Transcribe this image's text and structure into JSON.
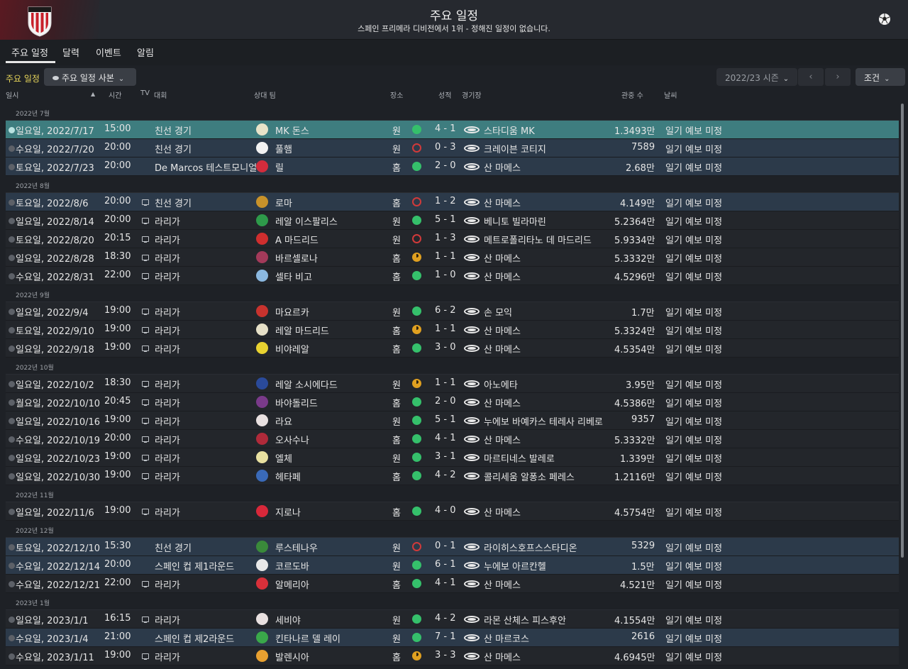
{
  "header": {
    "title": "주요 일정",
    "subtitle": "스페인 프리메라 디비전에서 1위 - 정해진 일정이 없습니다."
  },
  "tabs": [
    "주요 일정",
    "달력",
    "이벤트",
    "알림"
  ],
  "toolbar": {
    "section_title": "주요 일정",
    "view_dropdown": "주요 일정 사본",
    "season": "2022/23 시즌",
    "prev": "‹",
    "next": "›",
    "filter": "조건"
  },
  "columns": {
    "date": "일시",
    "time": "시간",
    "tv": "TV",
    "competition": "대회",
    "opponent": "상대 팀",
    "venue": "장소",
    "result": "성적",
    "stadium": "경기장",
    "attendance": "관중 수",
    "weather": "날씨"
  },
  "groups": [
    {
      "label": "2022년 7월",
      "matches": [
        {
          "date": "일요일, 2022/7/17",
          "time": "15:00",
          "tv": false,
          "comp": "친선 경기",
          "opp": "MK 돈스",
          "badge": "#e8e3c8",
          "venue": "원",
          "res": "w",
          "score": "4 - 1",
          "stadium": "스타디움 MK",
          "att": "1.3493만",
          "weather": "일기 예보 미정",
          "style": "sel"
        },
        {
          "date": "수요일, 2022/7/20",
          "time": "20:00",
          "tv": false,
          "comp": "친선 경기",
          "opp": "풀햄",
          "badge": "#f2f2f2",
          "venue": "원",
          "res": "l",
          "score": "0 - 3",
          "stadium": "크레이븐 코티지",
          "att": "7589",
          "weather": "일기 예보 미정",
          "style": "blue"
        },
        {
          "date": "토요일, 2022/7/23",
          "time": "20:00",
          "tv": false,
          "comp": "De Marcos 테스트모니얼",
          "opp": "릴",
          "badge": "#d32c3c",
          "venue": "홈",
          "res": "w",
          "score": "2 - 0",
          "stadium": "산 마메스",
          "att": "2.68만",
          "weather": "일기 예보 미정",
          "style": "blue"
        }
      ]
    },
    {
      "label": "2022년 8월",
      "matches": [
        {
          "date": "토요일, 2022/8/6",
          "time": "20:00",
          "tv": true,
          "comp": "친선 경기",
          "opp": "로마",
          "badge": "#c8922a",
          "venue": "홈",
          "res": "l",
          "score": "1 - 2",
          "stadium": "산 마메스",
          "att": "4.149만",
          "weather": "일기 예보 미정",
          "style": "blue"
        },
        {
          "date": "일요일, 2022/8/14",
          "time": "20:00",
          "tv": true,
          "comp": "라리가",
          "opp": "레알 이스팔리스",
          "badge": "#2e9a4a",
          "venue": "원",
          "res": "w",
          "score": "5 - 1",
          "stadium": "베니토 빌라마린",
          "att": "5.2364만",
          "weather": "일기 예보 미정",
          "style": ""
        },
        {
          "date": "토요일, 2022/8/20",
          "time": "20:15",
          "tv": true,
          "comp": "라리가",
          "opp": "A 마드리드",
          "badge": "#cf2e2e",
          "venue": "원",
          "res": "l",
          "score": "1 - 3",
          "stadium": "메트로폴리타노 데 마드리드",
          "att": "5.9334만",
          "weather": "일기 예보 미정",
          "style": ""
        },
        {
          "date": "일요일, 2022/8/28",
          "time": "18:30",
          "tv": true,
          "comp": "라리가",
          "opp": "바르셀로나",
          "badge": "#a33a5a",
          "venue": "홈",
          "res": "d",
          "score": "1 - 1",
          "stadium": "산 마메스",
          "att": "5.3332만",
          "weather": "일기 예보 미정",
          "style": ""
        },
        {
          "date": "수요일, 2022/8/31",
          "time": "22:00",
          "tv": true,
          "comp": "라리가",
          "opp": "셀타 비고",
          "badge": "#8bb8e0",
          "venue": "홈",
          "res": "w",
          "score": "1 - 0",
          "stadium": "산 마메스",
          "att": "4.5296만",
          "weather": "일기 예보 미정",
          "style": ""
        }
      ]
    },
    {
      "label": "2022년 9월",
      "matches": [
        {
          "date": "일요일, 2022/9/4",
          "time": "19:00",
          "tv": true,
          "comp": "라리가",
          "opp": "마요르카",
          "badge": "#c8332e",
          "venue": "원",
          "res": "w",
          "score": "6 - 2",
          "stadium": "손 모익",
          "att": "1.7만",
          "weather": "일기 예보 미정",
          "style": ""
        },
        {
          "date": "토요일, 2022/9/10",
          "time": "19:00",
          "tv": true,
          "comp": "라리가",
          "opp": "레알 마드리드",
          "badge": "#e6e0c8",
          "venue": "홈",
          "res": "d",
          "score": "1 - 1",
          "stadium": "산 마메스",
          "att": "5.3324만",
          "weather": "일기 예보 미정",
          "style": ""
        },
        {
          "date": "일요일, 2022/9/18",
          "time": "19:00",
          "tv": true,
          "comp": "라리가",
          "opp": "비야레알",
          "badge": "#e8d230",
          "venue": "홈",
          "res": "w",
          "score": "3 - 0",
          "stadium": "산 마메스",
          "att": "4.5354만",
          "weather": "일기 예보 미정",
          "style": ""
        }
      ]
    },
    {
      "label": "2022년 10월",
      "matches": [
        {
          "date": "일요일, 2022/10/2",
          "time": "18:30",
          "tv": true,
          "comp": "라리가",
          "opp": "레알 소시에다드",
          "badge": "#2a4a9a",
          "venue": "원",
          "res": "d",
          "score": "1 - 1",
          "stadium": "아노에타",
          "att": "3.95만",
          "weather": "일기 예보 미정",
          "style": ""
        },
        {
          "date": "월요일, 2022/10/10",
          "time": "20:45",
          "tv": true,
          "comp": "라리가",
          "opp": "바야돌리드",
          "badge": "#7a3a8a",
          "venue": "홈",
          "res": "w",
          "score": "2 - 0",
          "stadium": "산 마메스",
          "att": "4.5386만",
          "weather": "일기 예보 미정",
          "style": ""
        },
        {
          "date": "일요일, 2022/10/16",
          "time": "19:00",
          "tv": true,
          "comp": "라리가",
          "opp": "라요",
          "badge": "#e8e0e0",
          "venue": "원",
          "res": "w",
          "score": "5 - 1",
          "stadium": "누에보 바예카스 테레사 리베로",
          "att": "9357",
          "weather": "일기 예보 미정",
          "style": ""
        },
        {
          "date": "수요일, 2022/10/19",
          "time": "20:00",
          "tv": true,
          "comp": "라리가",
          "opp": "오사수나",
          "badge": "#b02a3a",
          "venue": "홈",
          "res": "w",
          "score": "4 - 1",
          "stadium": "산 마메스",
          "att": "5.3332만",
          "weather": "일기 예보 미정",
          "style": ""
        },
        {
          "date": "일요일, 2022/10/23",
          "time": "19:00",
          "tv": true,
          "comp": "라리가",
          "opp": "엘체",
          "badge": "#e8e0a0",
          "venue": "원",
          "res": "w",
          "score": "3 - 1",
          "stadium": "마르티네스 발레로",
          "att": "1.339만",
          "weather": "일기 예보 미정",
          "style": ""
        },
        {
          "date": "일요일, 2022/10/30",
          "time": "19:00",
          "tv": true,
          "comp": "라리가",
          "opp": "헤타페",
          "badge": "#3a6ab8",
          "venue": "홈",
          "res": "w",
          "score": "4 - 2",
          "stadium": "콜리세움 알퐁소 페레스",
          "att": "1.2116만",
          "weather": "일기 예보 미정",
          "style": ""
        }
      ]
    },
    {
      "label": "2022년 11월",
      "matches": [
        {
          "date": "일요일, 2022/11/6",
          "time": "19:00",
          "tv": true,
          "comp": "라리가",
          "opp": "지로나",
          "badge": "#d8283a",
          "venue": "홈",
          "res": "w",
          "score": "4 - 0",
          "stadium": "산 마메스",
          "att": "4.5754만",
          "weather": "일기 예보 미정",
          "style": ""
        }
      ]
    },
    {
      "label": "2022년 12월",
      "matches": [
        {
          "date": "토요일, 2022/12/10",
          "time": "15:30",
          "tv": false,
          "comp": "친선 경기",
          "opp": "루스테나우",
          "badge": "#3a8a3a",
          "venue": "원",
          "res": "l",
          "score": "0 - 1",
          "stadium": "라이히스호프스스타디온",
          "att": "5329",
          "weather": "일기 예보 미정",
          "style": "blue"
        },
        {
          "date": "수요일, 2022/12/14",
          "time": "20:00",
          "tv": false,
          "comp": "스페인 컵 제1라운드",
          "opp": "코르도바",
          "badge": "#e8e8e8",
          "venue": "원",
          "res": "w",
          "score": "6 - 1",
          "stadium": "누에보 아르칸헬",
          "att": "1.5만",
          "weather": "일기 예보 미정",
          "style": "blue"
        },
        {
          "date": "수요일, 2022/12/21",
          "time": "22:00",
          "tv": true,
          "comp": "라리가",
          "opp": "알메리아",
          "badge": "#d8303a",
          "venue": "홈",
          "res": "w",
          "score": "4 - 1",
          "stadium": "산 마메스",
          "att": "4.521만",
          "weather": "일기 예보 미정",
          "style": ""
        }
      ]
    },
    {
      "label": "2023년 1월",
      "matches": [
        {
          "date": "일요일, 2023/1/1",
          "time": "16:15",
          "tv": true,
          "comp": "라리가",
          "opp": "세비야",
          "badge": "#e8e0e0",
          "venue": "원",
          "res": "w",
          "score": "4 - 2",
          "stadium": "라몬 산체스 피스후안",
          "att": "4.1554만",
          "weather": "일기 예보 미정",
          "style": ""
        },
        {
          "date": "수요일, 2023/1/4",
          "time": "21:00",
          "tv": false,
          "comp": "스페인 컵 제2라운드",
          "opp": "킨타나르 델 레이",
          "badge": "#3aa84a",
          "venue": "원",
          "res": "w",
          "score": "7 - 1",
          "stadium": "산 마르코스",
          "att": "2616",
          "weather": "일기 예보 미정",
          "style": "blue"
        },
        {
          "date": "수요일, 2023/1/11",
          "time": "19:00",
          "tv": true,
          "comp": "라리가",
          "opp": "발렌시아",
          "badge": "#e8a030",
          "venue": "홈",
          "res": "d",
          "score": "3 - 3",
          "stadium": "산 마메스",
          "att": "4.6945만",
          "weather": "일기 예보 미정",
          "style": ""
        }
      ]
    }
  ]
}
